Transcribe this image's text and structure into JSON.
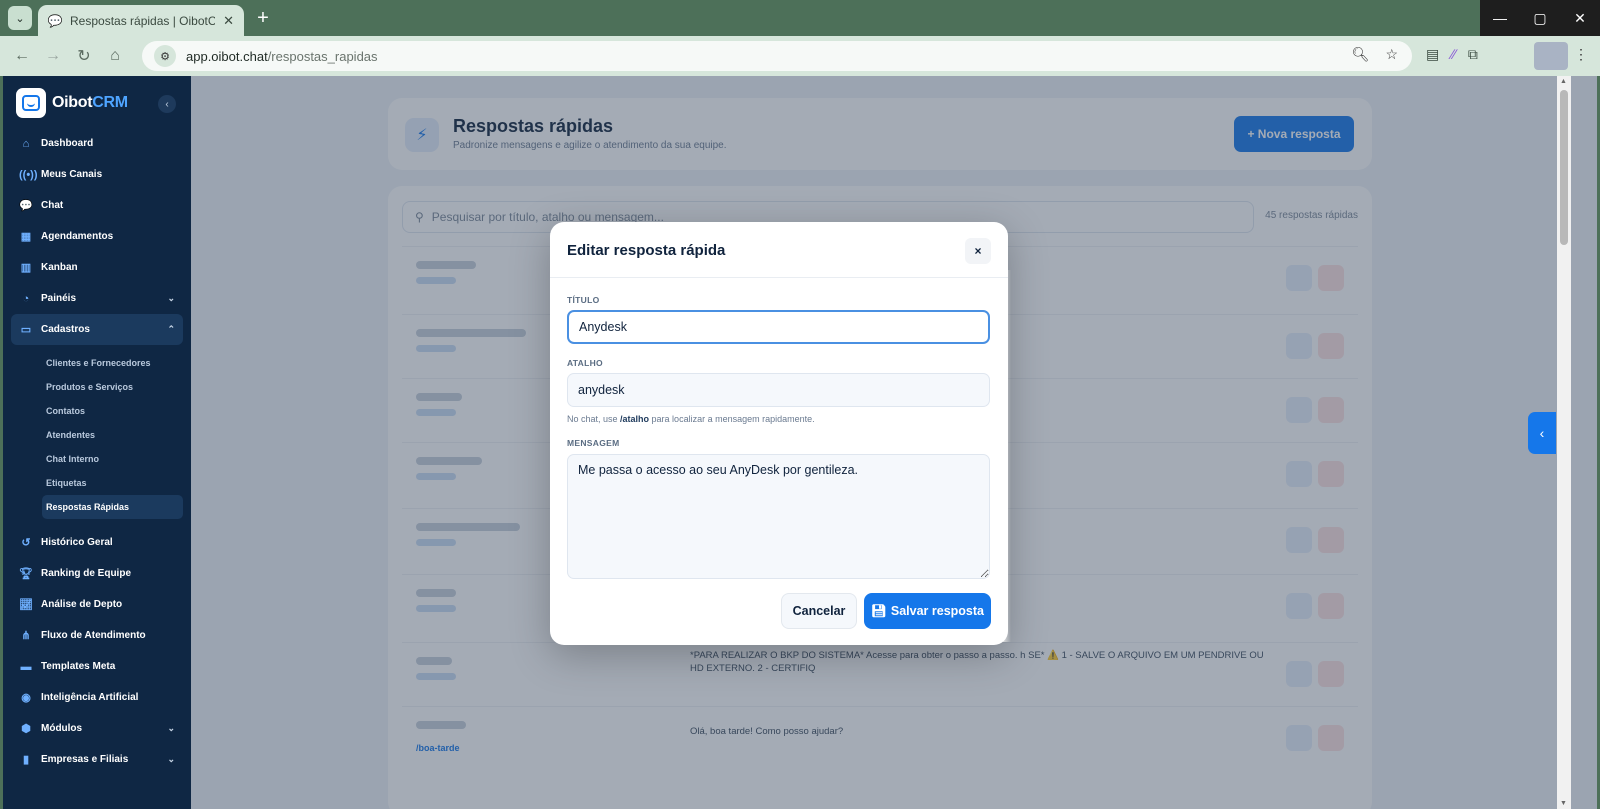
{
  "browser": {
    "tab_title": "Respostas rápidas | OibotCRM",
    "url_domain": "app.oibot.chat",
    "url_path": "/respostas_rapidas"
  },
  "sidebar": {
    "brand_first": "Oibot",
    "brand_second": "CRM",
    "items": [
      {
        "label": "Dashboard",
        "icon": "home-icon"
      },
      {
        "label": "Meus Canais",
        "icon": "broadcast-icon"
      },
      {
        "label": "Chat",
        "icon": "chat-icon"
      },
      {
        "label": "Agendamentos",
        "icon": "calendar-icon"
      },
      {
        "label": "Kanban",
        "icon": "kanban-icon"
      },
      {
        "label": "Painéis",
        "icon": "pie-chart-icon"
      },
      {
        "label": "Cadastros",
        "icon": "id-card-icon"
      }
    ],
    "cadastros_sub": [
      "Clientes e Fornecedores",
      "Produtos e Serviços",
      "Contatos",
      "Atendentes",
      "Chat Interno",
      "Etiquetas",
      "Respostas Rápidas"
    ],
    "items_after": [
      {
        "label": "Histórico Geral",
        "icon": "history-icon"
      },
      {
        "label": "Ranking de Equipe",
        "icon": "trophy-icon"
      },
      {
        "label": "Análise de Depto",
        "icon": "line-chart-icon"
      },
      {
        "label": "Fluxo de Atendimento",
        "icon": "flow-icon"
      },
      {
        "label": "Templates Meta",
        "icon": "template-icon"
      },
      {
        "label": "Inteligência Artificial",
        "icon": "brain-icon"
      },
      {
        "label": "Módulos",
        "icon": "modules-icon"
      },
      {
        "label": "Empresas e Filiais",
        "icon": "building-icon"
      }
    ]
  },
  "page": {
    "title": "Respostas rápidas",
    "subtitle": "Padronize mensagens e agilize o atendimento da sua equipe.",
    "new_button": "+ Nova resposta",
    "search_placeholder": "Pesquisar por título, atalho ou mensagem...",
    "count": "45 respostas rápidas",
    "row_msg_backup": "*PARA REALIZAR O BKP DO SISTEMA* Acesse para obter o passo a passo. h SE* ⚠️ 1 - SALVE O ARQUIVO EM UM PENDRIVE OU HD EXTERNO. 2 - CERTIFIQ",
    "row_msg_last": "Olá, boa tarde! Como posso ajudar?",
    "row_shortcut_last": "/boa-tarde"
  },
  "modal": {
    "title": "Editar resposta rápida",
    "close": "×",
    "titulo_label": "TÍTULO",
    "titulo_value": "Anydesk",
    "atalho_label": "ATALHO",
    "atalho_value": "anydesk",
    "help_prefix": "No chat, use ",
    "help_code": "/atalho",
    "help_suffix": " para localizar a mensagem rapidamente.",
    "mensagem_label": "MENSAGEM",
    "mensagem_value": "Me passa o acesso ao seu AnyDesk por gentileza.",
    "cancel": "Cancelar",
    "save": "Salvar resposta"
  },
  "colors": {
    "primary": "#1577ea",
    "sidebar_bg": "#0f2744",
    "browser_frame": "#4d7059"
  }
}
